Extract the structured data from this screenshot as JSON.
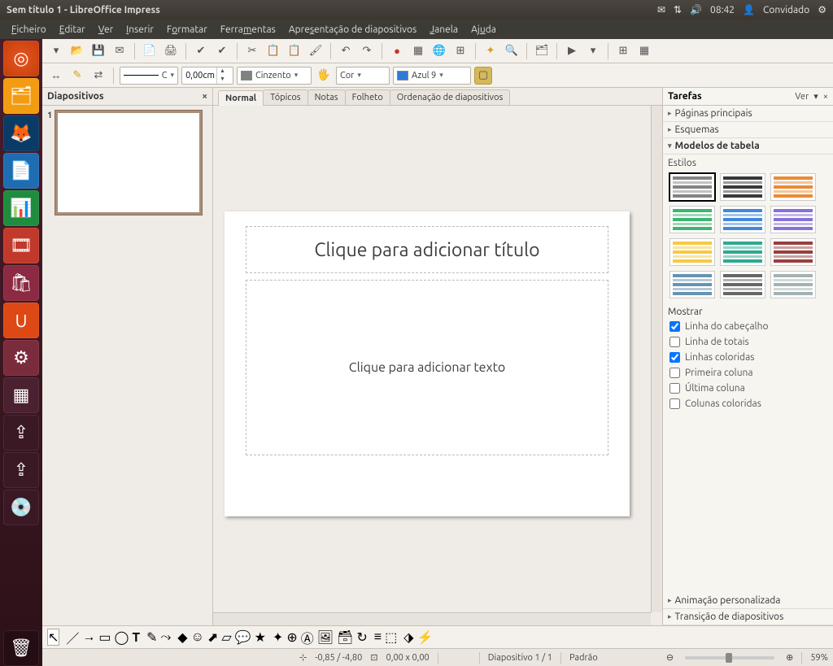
{
  "window_title": "Sem título 1 - LibreOffice Impress",
  "clock": "08:42",
  "user": "Convidado",
  "menu": [
    "Ficheiro",
    "Editar",
    "Ver",
    "Inserir",
    "Formatar",
    "Ferramentas",
    "Apresentação de diapositivos",
    "Janela",
    "Ajuda"
  ],
  "toolbar2": {
    "line_style": "C",
    "line_width": "0,00cm",
    "fill_color_label": "Cinzento",
    "fill_mode_label": "Cor",
    "line_color_label": "Azul 9"
  },
  "panels": {
    "slides_title": "Diapositivos",
    "tabs": [
      "Normal",
      "Tópicos",
      "Notas",
      "Folheto",
      "Ordenação de diapositivos"
    ],
    "active_tab": "Normal",
    "tasks_title": "Tarefas",
    "tasks_view": "Ver",
    "sections": {
      "master": "Páginas principais",
      "layouts": "Esquemas",
      "table": "Modelos de tabela",
      "custom_anim": "Animação personalizada",
      "transition": "Transição de diapositivos"
    },
    "styles_label": "Estilos",
    "show_label": "Mostrar",
    "checks": {
      "header_row": "Linha do cabeçalho",
      "total_row": "Linha de totais",
      "banded_rows": "Linhas coloridas",
      "first_col": "Primeira coluna",
      "last_col": "Última coluna",
      "banded_cols": "Colunas coloridas"
    }
  },
  "slide": {
    "title_ph": "Clique para adicionar título",
    "content_ph": "Clique para adicionar texto"
  },
  "status": {
    "coords": "-0,85 / -4,80",
    "size": "0,00 x 0,00",
    "slide": "Diapositivo 1 / 1",
    "layout": "Padrão",
    "zoom": "59%"
  },
  "launcher_icons": [
    "dash",
    "files",
    "firefox",
    "writer",
    "calc",
    "impress",
    "software",
    "ubuntu-one",
    "settings",
    "workspaces",
    "usb1",
    "usb2",
    "disc"
  ],
  "table_style_colors": [
    "#777",
    "#222",
    "#e67e22",
    "#27ae60",
    "#2e7bd6",
    "#7b5fd6",
    "#f4c430",
    "#16a085",
    "#8e2a2a",
    "#5588aa",
    "#555",
    "#9aa"
  ]
}
